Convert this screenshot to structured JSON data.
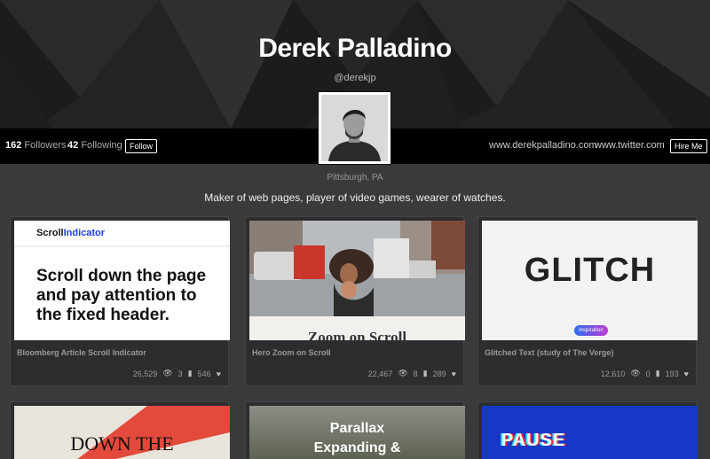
{
  "profile": {
    "name": "Derek Palladino",
    "handle": "@derekjp",
    "location": "Pittsburgh, PA",
    "bio": "Maker of web pages, player of video games, wearer of watches."
  },
  "stats": {
    "followers_count": "162",
    "followers_label": "Followers",
    "following_count": "42",
    "following_label": "Following",
    "follow_button": "Follow"
  },
  "links": {
    "website": "www.derekpalladino.com",
    "twitter": "www.twitter.com",
    "hire_button": "Hire Me"
  },
  "cards": [
    {
      "title": "Bloomberg Article Scroll Indicator",
      "views": "26,529",
      "comments": "3",
      "likes": "546",
      "thumb_logo_a": "Scroll",
      "thumb_logo_b": "Indicator",
      "thumb_text": "Scroll down the page and pay attention to the fixed header."
    },
    {
      "title": "Hero Zoom on Scroll",
      "views": "22,467",
      "comments": "8",
      "likes": "289",
      "thumb_caption": "Zoom on Scroll"
    },
    {
      "title": "Glitched Text (study of The Verge)",
      "views": "12,610",
      "comments": "0",
      "likes": "193",
      "thumb_text": "GLITCH",
      "thumb_pill": "Inspiration"
    }
  ],
  "row2": [
    {
      "thumb_text": "DOWN THE"
    },
    {
      "thumb_text_1": "Parallax",
      "thumb_text_2": "Expanding &"
    },
    {
      "thumb_text": "PAUSE"
    }
  ],
  "icons": {
    "views": "eye-icon",
    "comments": "comment-icon",
    "likes": "heart-icon"
  },
  "colors": {
    "background": "#3a3a3d",
    "bar": "#000000",
    "indicator_blue": "#1a3fd8",
    "glitch_pill": "#7a3df0",
    "pause_blue": "#1638c8"
  }
}
